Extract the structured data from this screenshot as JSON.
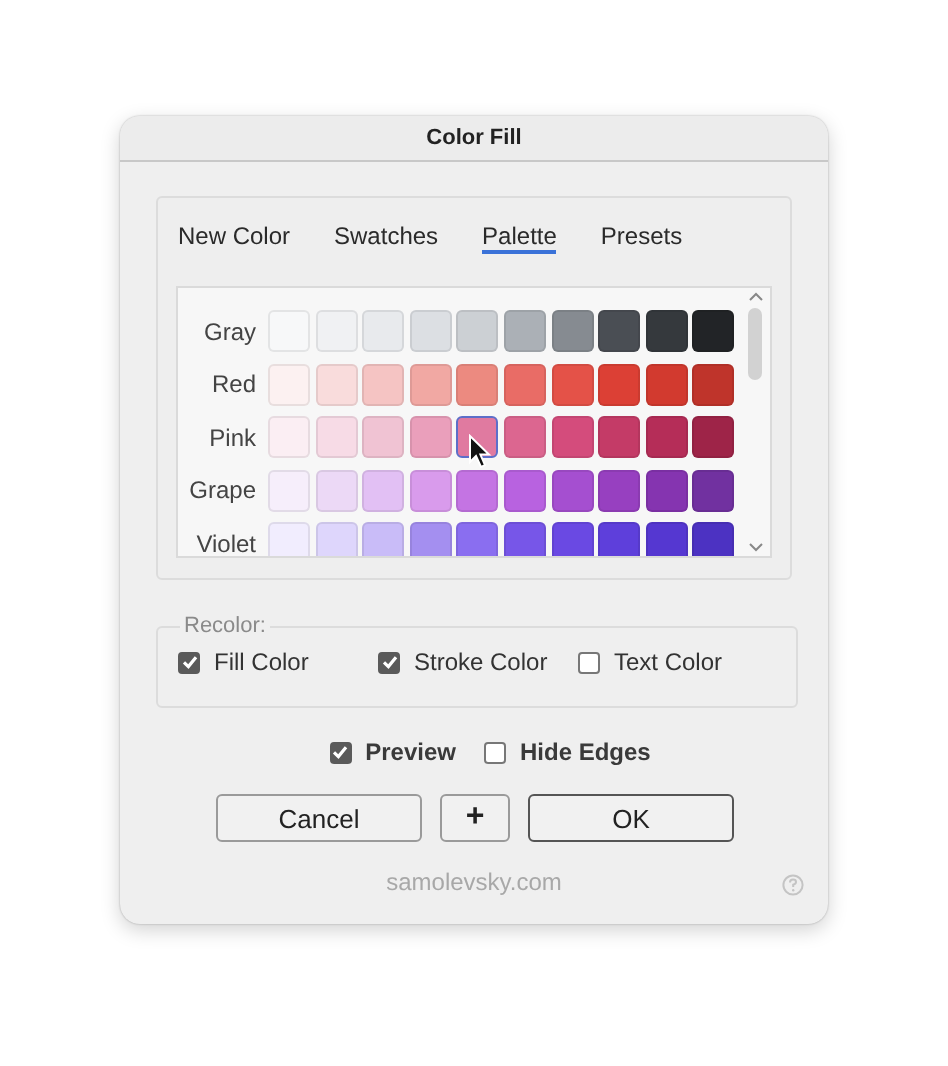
{
  "window": {
    "title": "Color Fill"
  },
  "tabs": [
    {
      "label": "New Color",
      "selected": false
    },
    {
      "label": "Swatches",
      "selected": false
    },
    {
      "label": "Palette",
      "selected": true
    },
    {
      "label": "Presets",
      "selected": false
    }
  ],
  "palette": {
    "rows": [
      {
        "name": "Gray",
        "swatches": [
          {
            "color": "#f7f8f9",
            "selected": false
          },
          {
            "color": "#f0f1f3",
            "selected": false
          },
          {
            "color": "#e8eaed",
            "selected": false
          },
          {
            "color": "#dcdfe3",
            "selected": false
          },
          {
            "color": "#ccd0d4",
            "selected": false
          },
          {
            "color": "#abb0b6",
            "selected": false
          },
          {
            "color": "#868b91",
            "selected": false
          },
          {
            "color": "#4a4e54",
            "selected": false
          },
          {
            "color": "#35393d",
            "selected": false
          },
          {
            "color": "#222427",
            "selected": false
          }
        ]
      },
      {
        "name": "Red",
        "swatches": [
          {
            "color": "#fcf1f1",
            "selected": false
          },
          {
            "color": "#f9dcdc",
            "selected": false
          },
          {
            "color": "#f5c4c3",
            "selected": false
          },
          {
            "color": "#f1a8a3",
            "selected": false
          },
          {
            "color": "#ec8a80",
            "selected": false
          },
          {
            "color": "#e96c66",
            "selected": false
          },
          {
            "color": "#e45248",
            "selected": false
          },
          {
            "color": "#dc4035",
            "selected": false
          },
          {
            "color": "#d23a2f",
            "selected": false
          },
          {
            "color": "#bf342b",
            "selected": false
          }
        ]
      },
      {
        "name": "Pink",
        "swatches": [
          {
            "color": "#fbeef3",
            "selected": false
          },
          {
            "color": "#f7dbe6",
            "selected": false
          },
          {
            "color": "#f0c3d3",
            "selected": false
          },
          {
            "color": "#ea9fbb",
            "selected": false
          },
          {
            "color": "#e07aa0",
            "selected": true
          },
          {
            "color": "#dc6690",
            "selected": false
          },
          {
            "color": "#d44c7c",
            "selected": false
          },
          {
            "color": "#c43b67",
            "selected": false
          },
          {
            "color": "#b52d58",
            "selected": false
          },
          {
            "color": "#9e2448",
            "selected": false
          }
        ]
      },
      {
        "name": "Grape",
        "swatches": [
          {
            "color": "#f6eefb",
            "selected": false
          },
          {
            "color": "#ecd9f6",
            "selected": false
          },
          {
            "color": "#e2c0f4",
            "selected": false
          },
          {
            "color": "#d99bec",
            "selected": false
          },
          {
            "color": "#c474e3",
            "selected": false
          },
          {
            "color": "#b862e0",
            "selected": false
          },
          {
            "color": "#a54fd0",
            "selected": false
          },
          {
            "color": "#9740c0",
            "selected": false
          },
          {
            "color": "#8534b0",
            "selected": false
          },
          {
            "color": "#7131a0",
            "selected": false
          }
        ]
      },
      {
        "name": "Violet",
        "swatches": [
          {
            "color": "#f1edfe",
            "selected": false
          },
          {
            "color": "#ded6fc",
            "selected": false
          },
          {
            "color": "#c9bcf8",
            "selected": false
          },
          {
            "color": "#a48ff0",
            "selected": false
          },
          {
            "color": "#8a6ef0",
            "selected": false
          },
          {
            "color": "#7756e8",
            "selected": false
          },
          {
            "color": "#6a49e3",
            "selected": false
          },
          {
            "color": "#5e3fdb",
            "selected": false
          },
          {
            "color": "#5537d1",
            "selected": false
          },
          {
            "color": "#4c32c2",
            "selected": false
          }
        ]
      }
    ]
  },
  "recolor": {
    "legend": "Recolor:",
    "options": [
      {
        "label": "Fill Color",
        "checked": true
      },
      {
        "label": "Stroke Color",
        "checked": true
      },
      {
        "label": "Text Color",
        "checked": false
      }
    ]
  },
  "options": [
    {
      "label": "Preview",
      "checked": true
    },
    {
      "label": "Hide Edges",
      "checked": false
    }
  ],
  "buttons": [
    {
      "label": "Cancel",
      "kind": "normal"
    },
    {
      "label": "+",
      "kind": "icon"
    },
    {
      "label": "OK",
      "kind": "default"
    }
  ],
  "footer": {
    "credit": "samolevsky.com"
  }
}
